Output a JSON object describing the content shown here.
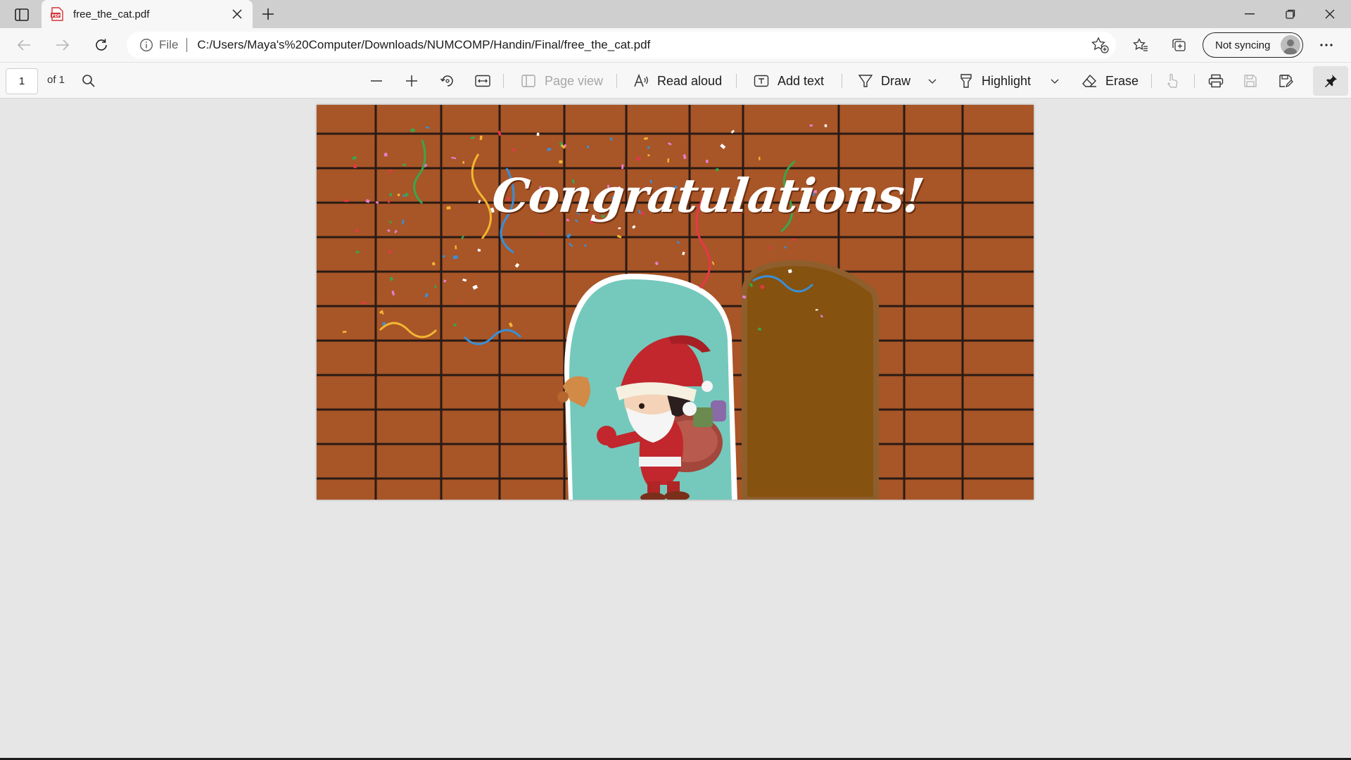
{
  "window": {
    "tab_title": "free_the_cat.pdf"
  },
  "address_bar": {
    "scheme": "File",
    "url": "C:/Users/Maya's%20Computer/Downloads/NUMCOMP/Handin/Final/free_the_cat.pdf"
  },
  "profile": {
    "sync_label": "Not syncing"
  },
  "pdf_toolbar": {
    "page_number": "1",
    "page_count": "of 1",
    "page_view_label": "Page view",
    "read_aloud_label": "Read aloud",
    "add_text_label": "Add text",
    "draw_label": "Draw",
    "highlight_label": "Highlight",
    "erase_label": "Erase"
  },
  "document": {
    "heading": "Congratulations!",
    "colors": {
      "brick": "#a85527",
      "mortar": "#2a1a14",
      "door_open": "#74c9bc",
      "door_closed": "#86520f"
    }
  }
}
